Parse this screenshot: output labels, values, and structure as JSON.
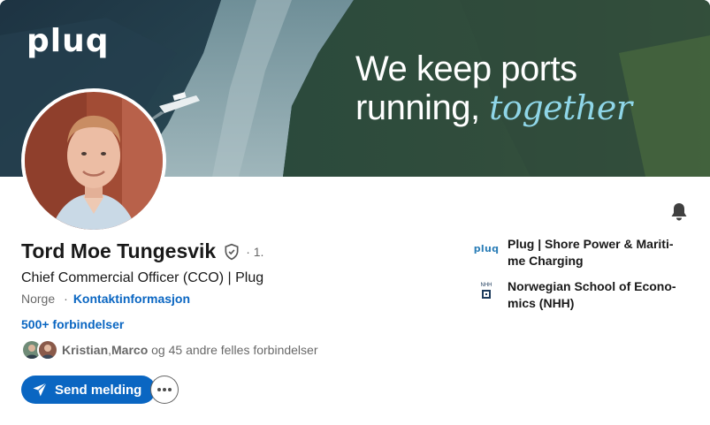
{
  "banner": {
    "brand_logo": "pluq",
    "tagline_line1": "We keep ports",
    "tagline_line2_plain": "running, ",
    "tagline_line2_accent": "together",
    "accent_color": "#8fd6e8"
  },
  "profile": {
    "name": "Tord Moe Tungesvik",
    "degree": "· 1.",
    "headline": "Chief Commercial Officer (CCO) | Plug",
    "location": "Norge",
    "location_separator": "·",
    "contact_info_label": "Kontaktinformasjon",
    "connections_label": "500+ forbindelser",
    "mutual_names": "Kristian",
    "mutual_names_sep": ", ",
    "mutual_names_2": "Marco",
    "mutual_suffix": " og 45 andre felles forbindelser"
  },
  "actions": {
    "send_message_label": "Send melding",
    "more_icon": "more-horizontal-icon",
    "bell_icon": "bell-icon",
    "primary_color": "#0a66c2"
  },
  "organizations": [
    {
      "logo_text": "pluq",
      "name": "Plug | Shore Power & Mariti-me Charging"
    },
    {
      "logo_text": "NHH",
      "name": "Norwegian School of Econo-mics (NHH)"
    }
  ]
}
